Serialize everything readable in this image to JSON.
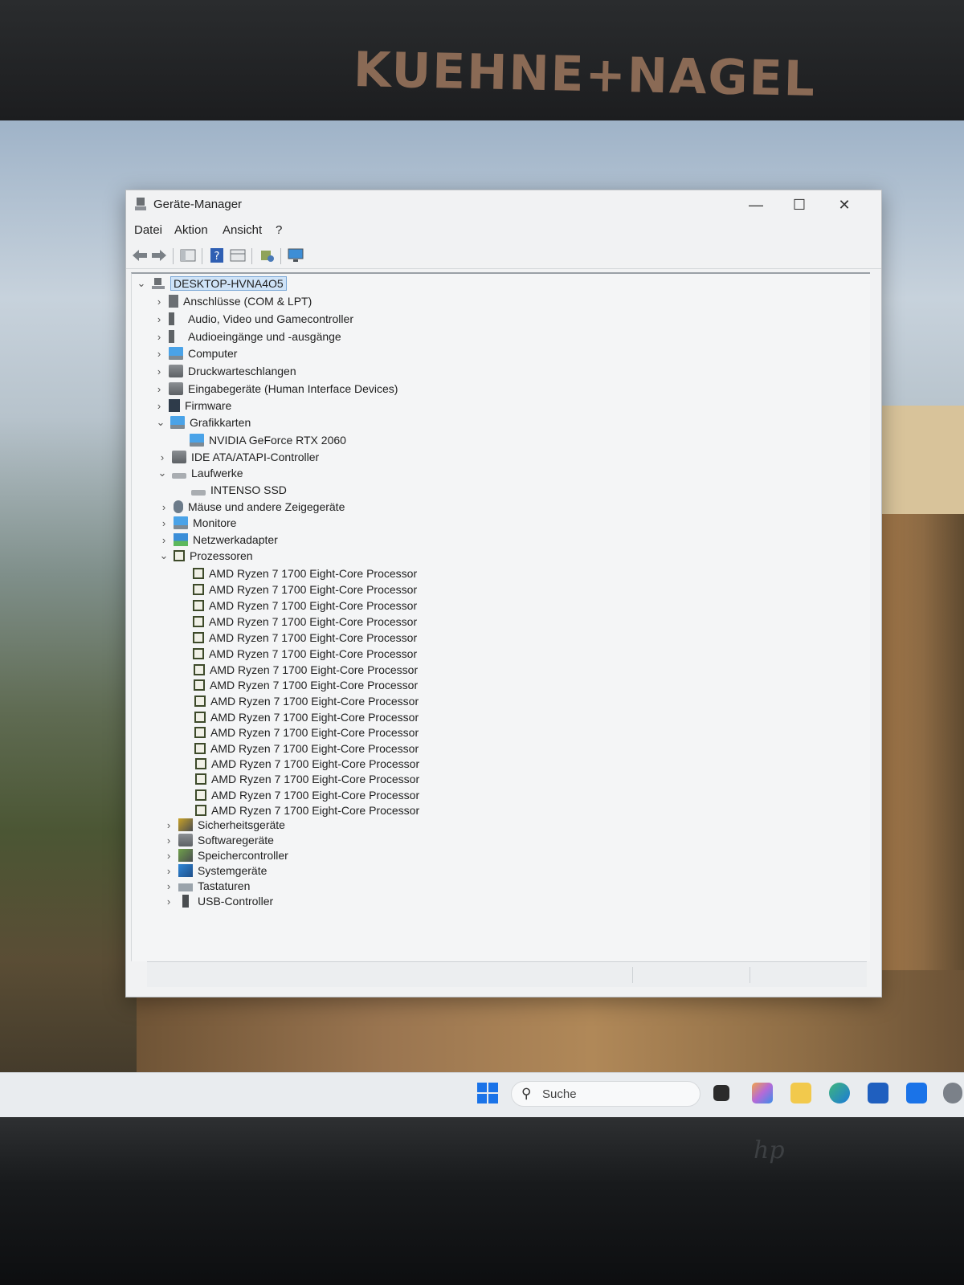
{
  "monitor": {
    "brand_text": "KUEHNE+NAGEL",
    "bottom_logo": "hp"
  },
  "window": {
    "title": "Geräte-Manager",
    "controls": {
      "minimize": "—",
      "maximize": "☐",
      "close": "✕"
    }
  },
  "menu": [
    "Datei",
    "Aktion",
    "Ansicht",
    "?"
  ],
  "toolbar": [
    "back-arrow-icon",
    "forward-arrow-icon",
    "properties-pane-icon",
    "help-icon",
    "device-view-icon",
    "scan-hardware-icon",
    "monitor-icon"
  ],
  "tree": {
    "root": "DESKTOP-HVNA4O5",
    "categories": [
      {
        "label": "Anschlüsse (COM & LPT)",
        "expanded": false,
        "icon": "port-icon"
      },
      {
        "label": "Audio, Video und Gamecontroller",
        "expanded": false,
        "icon": "speaker-icon"
      },
      {
        "label": "Audioeingänge und -ausgänge",
        "expanded": false,
        "icon": "speaker-icon"
      },
      {
        "label": "Computer",
        "expanded": false,
        "icon": "computer-icon"
      },
      {
        "label": "Druckwarteschlangen",
        "expanded": false,
        "icon": "printer-icon"
      },
      {
        "label": "Eingabegeräte (Human Interface Devices)",
        "expanded": false,
        "icon": "hid-icon"
      },
      {
        "label": "Firmware",
        "expanded": false,
        "icon": "firmware-icon"
      },
      {
        "label": "Grafikkarten",
        "expanded": true,
        "icon": "display-adapter-icon",
        "children": [
          "NVIDIA GeForce RTX 2060"
        ]
      },
      {
        "label": "IDE ATA/ATAPI-Controller",
        "expanded": false,
        "icon": "ide-controller-icon"
      },
      {
        "label": "Laufwerke",
        "expanded": true,
        "icon": "drive-icon",
        "children": [
          "INTENSO SSD"
        ]
      },
      {
        "label": "Mäuse und andere Zeigegeräte",
        "expanded": false,
        "icon": "mouse-icon"
      },
      {
        "label": "Monitore",
        "expanded": false,
        "icon": "monitor-icon"
      },
      {
        "label": "Netzwerkadapter",
        "expanded": false,
        "icon": "network-adapter-icon"
      },
      {
        "label": "Prozessoren",
        "expanded": true,
        "icon": "processor-icon",
        "children": [
          "AMD Ryzen 7 1700 Eight-Core Processor",
          "AMD Ryzen 7 1700 Eight-Core Processor",
          "AMD Ryzen 7 1700 Eight-Core Processor",
          "AMD Ryzen 7 1700 Eight-Core Processor",
          "AMD Ryzen 7 1700 Eight-Core Processor",
          "AMD Ryzen 7 1700 Eight-Core Processor",
          "AMD Ryzen 7 1700 Eight-Core Processor",
          "AMD Ryzen 7 1700 Eight-Core Processor",
          "AMD Ryzen 7 1700 Eight-Core Processor",
          "AMD Ryzen 7 1700 Eight-Core Processor",
          "AMD Ryzen 7 1700 Eight-Core Processor",
          "AMD Ryzen 7 1700 Eight-Core Processor",
          "AMD Ryzen 7 1700 Eight-Core Processor",
          "AMD Ryzen 7 1700 Eight-Core Processor",
          "AMD Ryzen 7 1700 Eight-Core Processor",
          "AMD Ryzen 7 1700 Eight-Core Processor"
        ]
      },
      {
        "label": "Sicherheitsgeräte",
        "expanded": false,
        "icon": "security-device-icon"
      },
      {
        "label": "Softwaregeräte",
        "expanded": false,
        "icon": "software-device-icon"
      },
      {
        "label": "Speichercontroller",
        "expanded": false,
        "icon": "storage-controller-icon"
      },
      {
        "label": "Systemgeräte",
        "expanded": false,
        "icon": "system-device-icon"
      },
      {
        "label": "Tastaturen",
        "expanded": false,
        "icon": "keyboard-icon"
      },
      {
        "label": "USB-Controller",
        "expanded": false,
        "icon": "usb-icon"
      }
    ]
  },
  "taskbar": {
    "search_placeholder": "Suche",
    "apps": [
      "task-view-icon",
      "copilot-icon",
      "file-explorer-icon",
      "edge-icon",
      "store-icon",
      "outlook-icon",
      "settings-icon"
    ]
  },
  "colors": {
    "selection": "#cfe3f7",
    "window_bg": "#f1f2f3",
    "accent": "#1a73e8"
  }
}
